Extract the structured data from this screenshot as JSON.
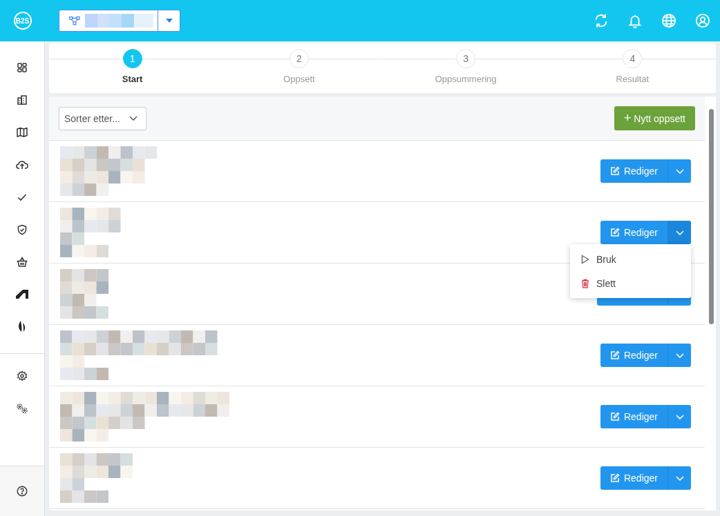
{
  "brand": {
    "logo": "B2S"
  },
  "project_selector": {
    "kind": "redacted"
  },
  "steps": [
    {
      "number": "1",
      "label": "Start",
      "selected": true
    },
    {
      "number": "2",
      "label": "Oppsett",
      "selected": false
    },
    {
      "number": "3",
      "label": "Oppsummering",
      "selected": false
    },
    {
      "number": "4",
      "label": "Resultat",
      "selected": false
    }
  ],
  "toolbar": {
    "sort_placeholder": "Sorter etter...",
    "new_button": "Nytt oppsett",
    "new_icon": "+"
  },
  "rows": [
    {
      "edit_label": "Rediger",
      "menu_open": false
    },
    {
      "edit_label": "Rediger",
      "menu_open": true
    },
    {
      "menu_open": false
    },
    {
      "edit_label": "Rediger",
      "menu_open": false
    },
    {
      "edit_label": "Rediger",
      "menu_open": false
    },
    {
      "edit_label": "Rediger",
      "menu_open": false
    }
  ],
  "menu": [
    {
      "kind": "use",
      "label": "Bruk"
    },
    {
      "kind": "delete",
      "label": "Slett"
    }
  ]
}
